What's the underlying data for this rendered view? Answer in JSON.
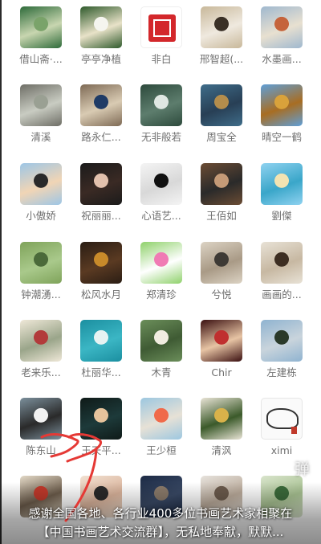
{
  "contacts": [
    {
      "name": "借山斋·...",
      "colors": [
        "#2e6b3a",
        "#7aa36a",
        "#c8d6b0"
      ]
    },
    {
      "name": "亭亭净植",
      "colors": [
        "#2f5a2c",
        "#f5f5ef",
        "#e8e2c8"
      ]
    },
    {
      "name": "非白",
      "colors": "seal"
    },
    {
      "name": "邢智超(...",
      "colors": [
        "#c8b89a",
        "#3a3026",
        "#efe9df"
      ]
    },
    {
      "name": "水墨画...",
      "colors": [
        "#9fb8cf",
        "#c5643c",
        "#e8e0d0"
      ]
    },
    {
      "name": "清溪",
      "colors": [
        "#6e6e66",
        "#9aa093",
        "#c9ccc2"
      ]
    },
    {
      "name": "路永仁...",
      "colors": [
        "#7e6a55",
        "#1f3b66",
        "#d9cbb3"
      ]
    },
    {
      "name": "无非般若",
      "colors": [
        "#2d4a3c",
        "#dfe7e2",
        "#5d7d6d"
      ]
    },
    {
      "name": "周宝全",
      "colors": [
        "#3f6d8a",
        "#b48d4c",
        "#283f55"
      ]
    },
    {
      "name": "晴空一鹤",
      "colors": [
        "#5f9fd8",
        "#d9a23b",
        "#a86d22"
      ]
    },
    {
      "name": "小傲娇",
      "colors": [
        "#9dc6e6",
        "#2a2a2a",
        "#f1d5b5"
      ]
    },
    {
      "name": "祝丽丽...",
      "colors": [
        "#1b1b1b",
        "#e2c1ad",
        "#3a2a24"
      ]
    },
    {
      "name": "心语艺...",
      "colors": [
        "#f4f4f4",
        "#111111",
        "#d8d8d8"
      ]
    },
    {
      "name": "王佰如",
      "colors": [
        "#6b4c34",
        "#c49a77",
        "#2a2a2a"
      ]
    },
    {
      "name": "劉傑",
      "colors": [
        "#8fd2f0",
        "#f2e3b2",
        "#3aa6c9"
      ]
    },
    {
      "name": "钟潮湧...",
      "colors": [
        "#7fa35a",
        "#4b6a3a",
        "#a9c98b"
      ]
    },
    {
      "name": "松风水月",
      "colors": [
        "#2a1d14",
        "#c88a2a",
        "#5a3a22"
      ]
    },
    {
      "name": "郑清珍",
      "colors": [
        "#8fd16b",
        "#f07bb4",
        "#ffffff"
      ]
    },
    {
      "name": "兮悦",
      "colors": [
        "#dcd3c4",
        "#3e3a35",
        "#a99a86"
      ]
    },
    {
      "name": "画画的...",
      "colors": [
        "#e8e2d6",
        "#3d2e22",
        "#c7b8a2"
      ]
    },
    {
      "name": "老来乐...",
      "colors": [
        "#efe8d8",
        "#b23b3b",
        "#9aa58a"
      ]
    },
    {
      "name": "杜丽华...",
      "colors": [
        "#1b8fa0",
        "#e6f3f2",
        "#3bb6c4"
      ]
    },
    {
      "name": "木青",
      "colors": [
        "#6b8e5a",
        "#f0ece0",
        "#3f5b34"
      ]
    },
    {
      "name": "Chir",
      "colors": [
        "#3a0f10",
        "#c0302f",
        "#e7c4a4"
      ]
    },
    {
      "name": "左建栋",
      "colors": [
        "#8fb3d0",
        "#2b3a2a",
        "#c9d4dc"
      ]
    },
    {
      "name": "陈东山",
      "colors": [
        "#7b8f9b",
        "#f2f2f2",
        "#2a2a2a"
      ]
    },
    {
      "name": "王天平...",
      "colors": [
        "#0f1a18",
        "#e6c39c",
        "#1d3a3a"
      ]
    },
    {
      "name": "王少桓",
      "colors": [
        "#9cc7e0",
        "#f06a4a",
        "#e7e1d6"
      ]
    },
    {
      "name": "清沨",
      "colors": [
        "#e9e4d6",
        "#d9b24a",
        "#3b5a2a"
      ]
    },
    {
      "name": "ximi",
      "colors": "xi"
    },
    {
      "name": "",
      "colors": [
        "#e2d8c6",
        "#c0392b",
        "#6b5b4a"
      ]
    },
    {
      "name": "",
      "colors": [
        "#f1e1d2",
        "#2a2a2a",
        "#d9b29a"
      ]
    },
    {
      "name": "",
      "colors": [
        "#1c2a44",
        "#8a7a6a",
        "#3a4a66"
      ]
    },
    {
      "name": "",
      "colors": [
        "#e6e2dc",
        "#6b5a4c",
        "#b9a999"
      ]
    },
    {
      "name": "",
      "colors": [
        "#d9e4cc",
        "#3b6a3a",
        "#a6c090"
      ]
    }
  ],
  "subtitle": {
    "line1": "感谢全国各地、各行业400多位书画艺术家相聚在",
    "line2": "【中国书画艺术交流群】，无私地奉献，默默..."
  },
  "danmu_label": "弹",
  "colors": {
    "label_text": "#6f6f6f",
    "scribble": "#e53935",
    "subtitle_text": "#ffffff"
  }
}
